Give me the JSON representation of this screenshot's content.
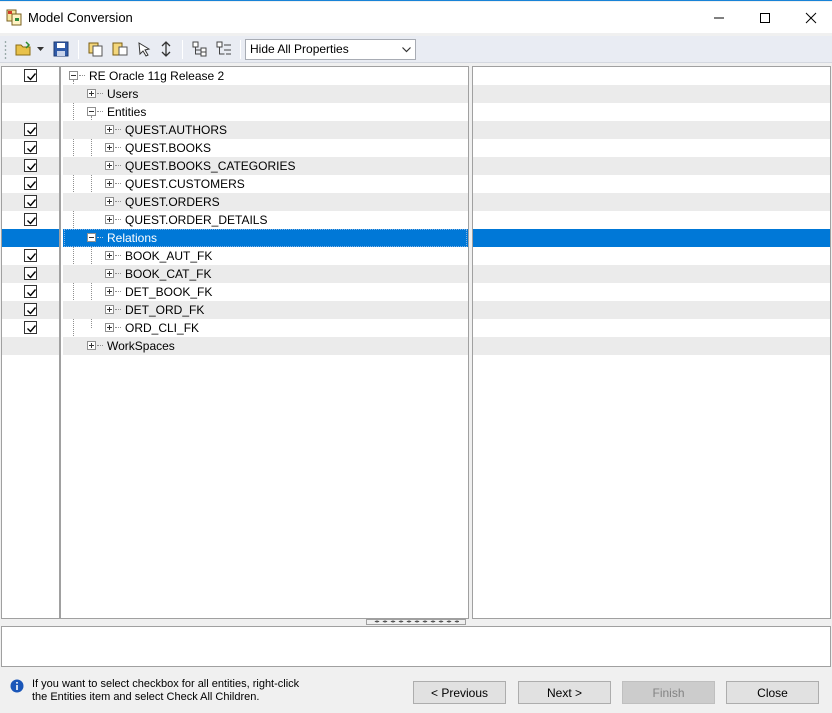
{
  "window": {
    "title": "Model Conversion"
  },
  "toolbar": {
    "icons": [
      "open-folder-icon",
      "save-icon",
      "copy-icon",
      "paste-icon",
      "select-icon",
      "sort-icon",
      "tree-expand-icon",
      "tree-collapse-icon"
    ],
    "property_filter": {
      "selected": "Hide All Properties"
    }
  },
  "tree": {
    "root": "RE Oracle 11g Release 2",
    "users": "Users",
    "entities": "Entities",
    "entity_items": [
      "QUEST.AUTHORS",
      "QUEST.BOOKS",
      "QUEST.BOOKS_CATEGORIES",
      "QUEST.CUSTOMERS",
      "QUEST.ORDERS",
      "QUEST.ORDER_DETAILS"
    ],
    "relations": "Relations",
    "relation_items": [
      "BOOK_AUT_FK",
      "BOOK_CAT_FK",
      "DET_BOOK_FK",
      "DET_ORD_FK",
      "ORD_CLI_FK"
    ],
    "workspaces": "WorkSpaces"
  },
  "footer": {
    "hint": "If you want to select checkbox for all entities, right-click the Entities item and select Check All Children.",
    "previous": "< Previous",
    "next": "Next >",
    "finish": "Finish",
    "close": "Close"
  },
  "colors": {
    "selection": "#0078d7",
    "accent": "#1883d7"
  }
}
